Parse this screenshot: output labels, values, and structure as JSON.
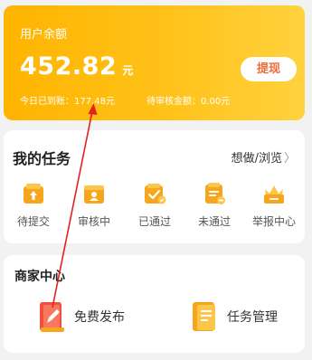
{
  "balance": {
    "title": "用户余额",
    "amount": "452.82",
    "unit": "元",
    "withdraw_label": "提现",
    "today_arrived": "今日已到账：177.48元",
    "pending_review": "待审核金额：0.00元"
  },
  "tasks": {
    "title": "我的任务",
    "link_label": "想做/浏览",
    "link_chevron": "〉",
    "items": [
      {
        "label": "待提交",
        "icon": "pending-submit-icon"
      },
      {
        "label": "审核中",
        "icon": "under-review-icon"
      },
      {
        "label": "已通过",
        "icon": "approved-icon"
      },
      {
        "label": "未通过",
        "icon": "rejected-icon"
      },
      {
        "label": "举报中心",
        "icon": "report-center-icon"
      }
    ]
  },
  "merchant": {
    "title": "商家中心",
    "items": [
      {
        "label": "免费发布",
        "icon": "free-publish-icon"
      },
      {
        "label": "任务管理",
        "icon": "task-management-icon"
      }
    ]
  },
  "colors": {
    "balance_gradient_start": "#ffb400",
    "balance_gradient_end": "#ffd23e",
    "withdraw_text": "#ef6a3a",
    "icon_orange": "#f7a51c",
    "publish_red": "#f0503c",
    "annotation_red": "#e52020"
  }
}
